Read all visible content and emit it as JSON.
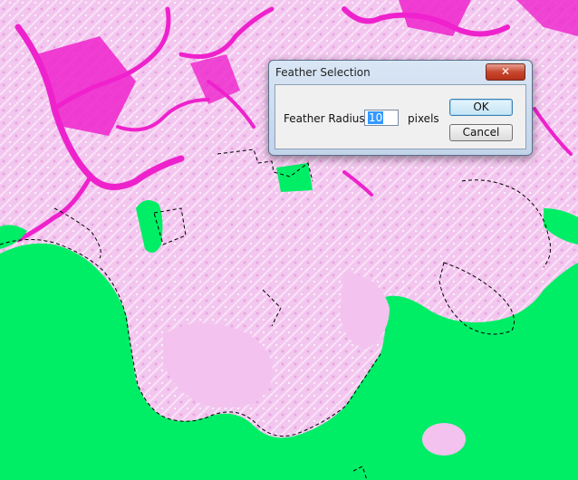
{
  "dialog": {
    "title": "Feather Selection",
    "close_label": "✕",
    "radius_label": "Feather Radius:",
    "radius_value": "10",
    "unit_label": "pixels",
    "ok_label": "OK",
    "cancel_label": "Cancel"
  },
  "colors": {
    "mask_green": "#00ee66",
    "terrain_pink": "#f4c8f0",
    "river_magenta": "#ee22cc"
  }
}
